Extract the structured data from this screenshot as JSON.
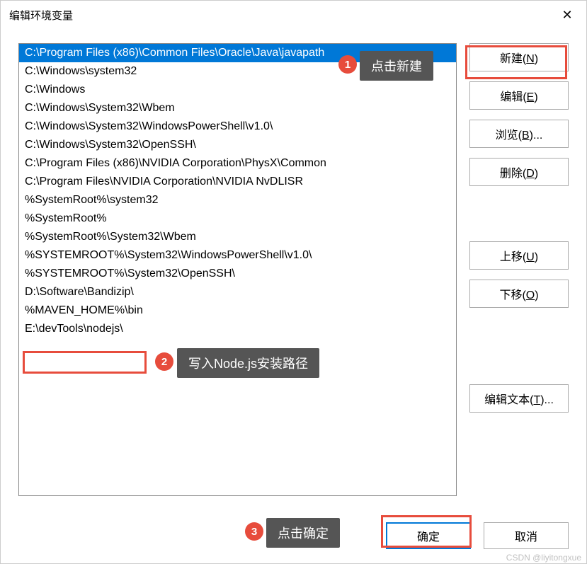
{
  "title": "编辑环境变量",
  "closeIcon": "✕",
  "listItems": [
    "C:\\Program Files (x86)\\Common Files\\Oracle\\Java\\javapath",
    "C:\\Windows\\system32",
    "C:\\Windows",
    "C:\\Windows\\System32\\Wbem",
    "C:\\Windows\\System32\\WindowsPowerShell\\v1.0\\",
    "C:\\Windows\\System32\\OpenSSH\\",
    "C:\\Program Files (x86)\\NVIDIA Corporation\\PhysX\\Common",
    "C:\\Program Files\\NVIDIA Corporation\\NVIDIA NvDLISR",
    "%SystemRoot%\\system32",
    "%SystemRoot%",
    "%SystemRoot%\\System32\\Wbem",
    "%SYSTEMROOT%\\System32\\WindowsPowerShell\\v1.0\\",
    "%SYSTEMROOT%\\System32\\OpenSSH\\",
    "D:\\Software\\Bandizip\\",
    "%MAVEN_HOME%\\bin",
    "E:\\devTools\\nodejs\\"
  ],
  "buttons": {
    "new": "新建(N)",
    "edit": "编辑(E)",
    "browse": "浏览(B)...",
    "delete": "删除(D)",
    "moveUp": "上移(U)",
    "moveDown": "下移(O)",
    "editText": "编辑文本(T)..."
  },
  "footer": {
    "ok": "确定",
    "cancel": "取消"
  },
  "annotations": {
    "badge1": "1",
    "tooltip1": "点击新建",
    "badge2": "2",
    "tooltip2": "写入Node.js安装路径",
    "badge3": "3",
    "tooltip3": "点击确定"
  },
  "watermark": "CSDN @liyitongxue"
}
